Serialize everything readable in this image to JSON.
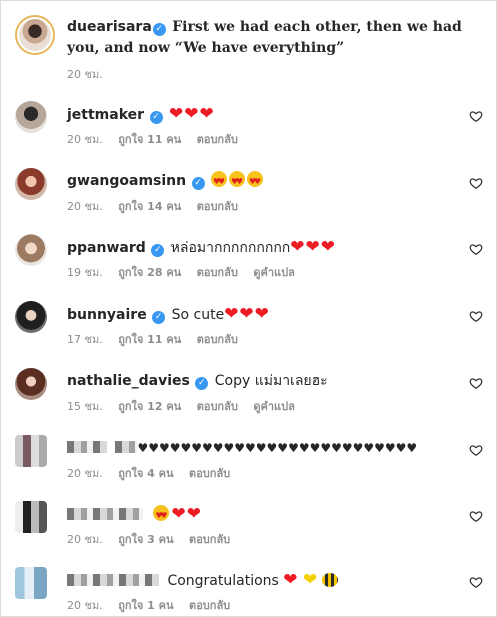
{
  "caption": {
    "username": "duearisara",
    "text": "First we had each other, then we had you, and now “We have everything”",
    "time": "20 ชม."
  },
  "labels": {
    "likes_prefix": "ถูกใจ",
    "likes_suffix": "คน",
    "reply": "ตอบกลับ",
    "translate": "ดูคำแปล"
  },
  "comments": [
    {
      "username": "jettmaker",
      "text": "",
      "emoji": "hearts3",
      "time": "20 ชม.",
      "likes": "ถูกใจ 11 คน",
      "reply": "ตอบกลับ",
      "translate": ""
    },
    {
      "username": "gwangoamsinn",
      "text": "",
      "emoji": "faces3",
      "time": "20 ชม.",
      "likes": "ถูกใจ 14 คน",
      "reply": "ตอบกลับ",
      "translate": ""
    },
    {
      "username": "ppanward",
      "text": "หล่อมากกกกกกกกก",
      "emoji": "hearts3",
      "time": "19 ชม.",
      "likes": "ถูกใจ 28 คน",
      "reply": "ตอบกลับ",
      "translate": "ดูคำแปล"
    },
    {
      "username": "bunnyaire",
      "text": "So cute",
      "emoji": "hearts3",
      "time": "17 ชม.",
      "likes": "ถูกใจ 11 คน",
      "reply": "ตอบกลับ",
      "translate": ""
    },
    {
      "username": "nathalie_davies",
      "text": "Copy แม่มาเลยฮะ",
      "emoji": "",
      "time": "15 ชม.",
      "likes": "ถูกใจ 12 คน",
      "reply": "ตอบกลับ",
      "translate": "ดูคำแปล"
    },
    {
      "username": "",
      "text": "",
      "emoji": "darkhearts",
      "time": "20 ชม.",
      "likes": "ถูกใจ 4 คน",
      "reply": "ตอบกลับ",
      "translate": ""
    },
    {
      "username": "",
      "text": "",
      "emoji": "face-hearts",
      "time": "20 ชม.",
      "likes": "ถูกใจ 3 คน",
      "reply": "ตอบกลับ",
      "translate": ""
    },
    {
      "username": "",
      "text": "Congratulations",
      "emoji": "congrats",
      "time": "20 ชม.",
      "likes": "ถูกใจ 1 คน",
      "reply": "ตอบกลับ",
      "translate": ""
    }
  ],
  "icons": {
    "verified": "verified-badge-icon",
    "like": "heart-outline-icon"
  },
  "colors": {
    "verified": "#3897f0",
    "meta": "#8e8e8e",
    "heart": "#ed1c24",
    "ring": "#e6b85c"
  }
}
